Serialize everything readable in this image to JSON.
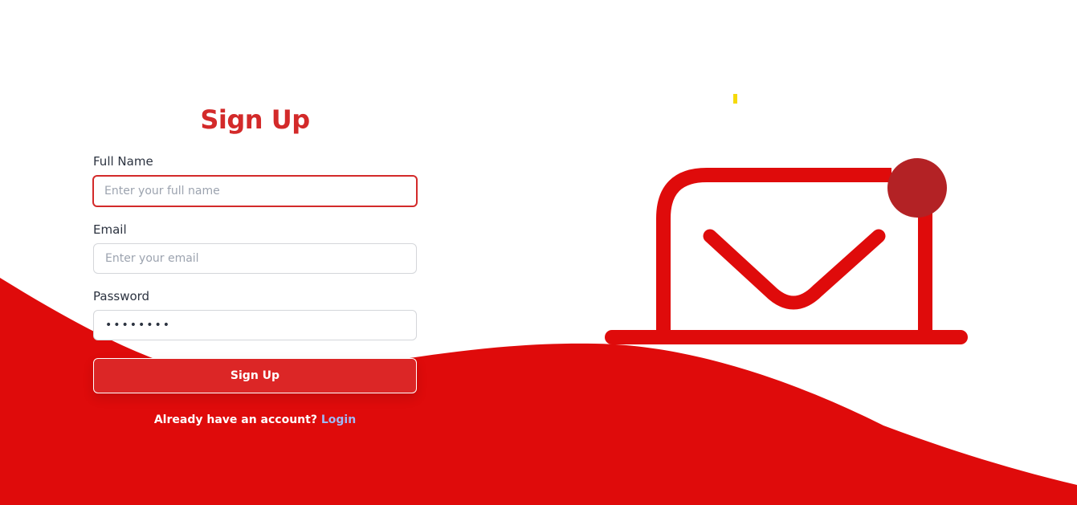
{
  "form": {
    "title": "Sign Up",
    "full_name": {
      "label": "Full Name",
      "placeholder": "Enter your full name",
      "value": ""
    },
    "email": {
      "label": "Email",
      "placeholder": "Enter your email",
      "value": ""
    },
    "password": {
      "label": "Password",
      "value": "••••••••"
    },
    "submit_label": "Sign Up",
    "login_prompt": "Already have an account?",
    "login_link": "Login"
  },
  "colors": {
    "brand": "#dc2626",
    "wave": "#df0b0b",
    "title": "#d32a2a",
    "notification_dot": "#b32225",
    "accent_yellow": "#f5d90a",
    "link": "#9fb8f5"
  },
  "illustration": {
    "icon": "laptop-mail-icon",
    "badge": "notification-dot-icon"
  }
}
